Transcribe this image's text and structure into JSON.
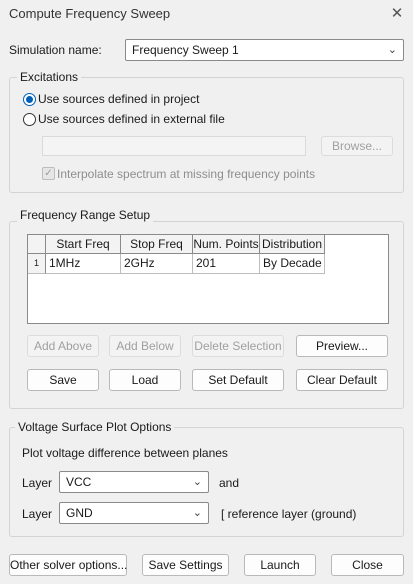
{
  "window": {
    "title": "Compute Frequency Sweep",
    "close_glyph": "✕"
  },
  "simulation": {
    "label": "Simulation name:",
    "value": "Frequency Sweep 1"
  },
  "excitations": {
    "title": "Excitations",
    "option_project": "Use sources defined in project",
    "option_file": "Use sources defined in external file",
    "file_path": "",
    "browse_label": "Browse...",
    "interpolate_label": "Interpolate spectrum at missing frequency points",
    "selected": "project"
  },
  "frequency_range": {
    "title": "Frequency Range Setup",
    "columns": [
      "Start Freq",
      "Stop Freq",
      "Num. Points",
      "Distribution"
    ],
    "rows": [
      {
        "index": "1",
        "cells": [
          "1MHz",
          "2GHz",
          "201",
          "By Decade"
        ]
      }
    ],
    "buttons": {
      "add_above": "Add Above",
      "add_below": "Add Below",
      "delete_selection": "Delete Selection",
      "preview": "Preview...",
      "save": "Save",
      "load": "Load",
      "set_default": "Set Default",
      "clear_default": "Clear Default"
    }
  },
  "voltage_plot": {
    "title": "Voltage Surface Plot Options",
    "description": "Plot voltage difference between planes",
    "layer_label": "Layer",
    "layer1": "VCC",
    "and_label": "and",
    "layer2": "GND",
    "reference_note": "[ reference layer (ground)"
  },
  "footer": {
    "other_solver": "Other solver options...",
    "save_settings": "Save Settings",
    "launch": "Launch",
    "close": "Close"
  },
  "icons": {
    "chevron": "chevron-down-icon",
    "close": "close-icon",
    "check": "checkmark-icon"
  },
  "colors": {
    "accent": "#005fb8",
    "background": "#f0f0f0"
  }
}
